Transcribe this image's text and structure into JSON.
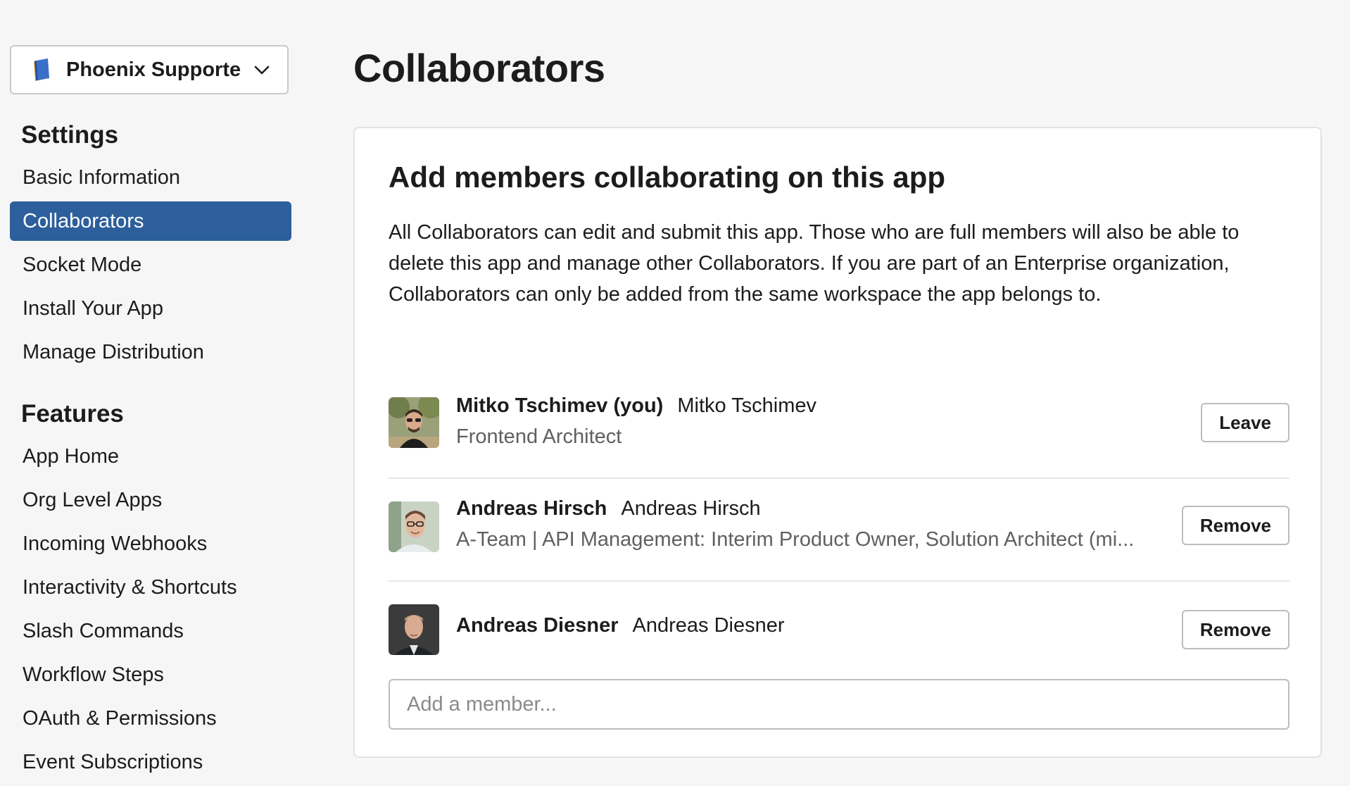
{
  "app_switcher": {
    "app_name": "Phoenix Supporter"
  },
  "sidebar": {
    "settings_heading": "Settings",
    "settings_items": [
      {
        "label": "Basic Information",
        "active": false
      },
      {
        "label": "Collaborators",
        "active": true
      },
      {
        "label": "Socket Mode",
        "active": false
      },
      {
        "label": "Install Your App",
        "active": false
      },
      {
        "label": "Manage Distribution",
        "active": false
      }
    ],
    "features_heading": "Features",
    "features_items": [
      {
        "label": "App Home"
      },
      {
        "label": "Org Level Apps"
      },
      {
        "label": "Incoming Webhooks"
      },
      {
        "label": "Interactivity & Shortcuts"
      },
      {
        "label": "Slash Commands"
      },
      {
        "label": "Workflow Steps"
      },
      {
        "label": "OAuth & Permissions"
      },
      {
        "label": "Event Subscriptions"
      }
    ]
  },
  "main": {
    "page_title": "Collaborators",
    "card_title": "Add members collaborating on this app",
    "card_description": "All Collaborators can edit and submit this app. Those who are full members will also be able to delete this app and manage other Collaborators. If you are part of an Enterprise organization, Collaborators can only be added from the same workspace the app belongs to.",
    "members": [
      {
        "display_name": "Mitko Tschimev (you)",
        "full_name": "Mitko Tschimev",
        "title": "Frontend Architect",
        "action_label": "Leave"
      },
      {
        "display_name": "Andreas Hirsch",
        "full_name": "Andreas Hirsch",
        "title": "A-Team | API Management: Interim Product Owner, Solution Architect (mi...",
        "action_label": "Remove"
      },
      {
        "display_name": "Andreas Diesner",
        "full_name": "Andreas Diesner",
        "title": "",
        "action_label": "Remove"
      }
    ],
    "add_member_placeholder": "Add a member..."
  },
  "colors": {
    "active_nav_bg": "#2c5f9b",
    "page_bg": "#f6f6f6",
    "card_bg": "#ffffff",
    "text_primary": "#1d1c1d",
    "text_secondary": "#616061"
  },
  "icons": {
    "app_icon": "book-icon",
    "switcher_chevron": "chevron-down-icon"
  }
}
